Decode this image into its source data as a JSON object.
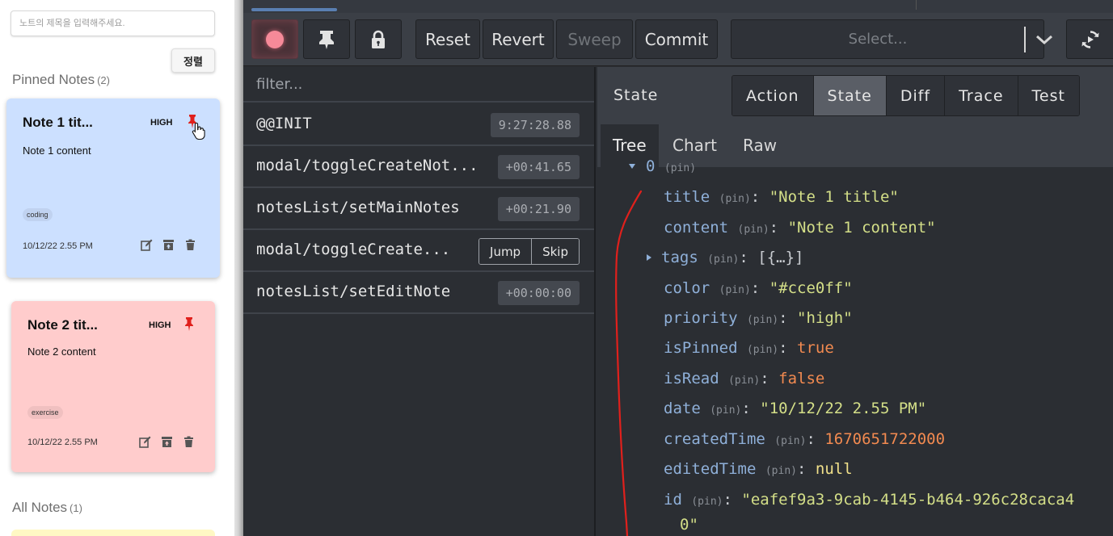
{
  "app": {
    "title_input": {
      "placeholder": "노트의 제목을 입력해주세요.",
      "value": ""
    },
    "sort_label": "정렬",
    "pinned_heading": {
      "label": "Pinned Notes",
      "count": "(2)"
    },
    "all_heading": {
      "label": "All Notes",
      "count": "(1)"
    },
    "notes": [
      {
        "title": "Note 1 tit...",
        "priority": "HIGH",
        "content": "Note 1 content",
        "tag": "coding",
        "date": "10/12/22 2.55 PM",
        "color": "#cce0ff",
        "pinned": true
      },
      {
        "title": "Note 2 tit...",
        "priority": "HIGH",
        "content": "Note 2 content",
        "tag": "exercise",
        "date": "10/12/22 2.55 PM",
        "color": "#ffcccc",
        "pinned": true
      }
    ],
    "icons": {
      "pin": "pin-icon",
      "edit": "edit-icon",
      "archive": "archive-icon",
      "delete": "trash-icon",
      "cursor": "hand-cursor-icon"
    }
  },
  "devtools": {
    "toolbar": {
      "record_icon": "record-icon",
      "pin_icon": "pin-icon",
      "lock_icon": "lock-icon",
      "reset": "Reset",
      "revert": "Revert",
      "sweep": "Sweep",
      "commit": "Commit",
      "select_placeholder": "Select...",
      "sync_icon": "sync-icon"
    },
    "filter_placeholder": "filter...",
    "actions": [
      {
        "name": "@@INIT",
        "time": "9:27:28.88"
      },
      {
        "name": "modal/toggleCreateNot...",
        "time": "+00:41.65"
      },
      {
        "name": "notesList/setMainNotes",
        "time": "+00:21.90"
      },
      {
        "name": "modal/toggleCreate...",
        "jump": "Jump",
        "skip": "Skip"
      },
      {
        "name": "notesList/setEditNote",
        "time": "+00:00:00"
      }
    ],
    "inspector": {
      "title": "State",
      "monitor_tabs": [
        "Action",
        "State",
        "Diff",
        "Trace",
        "Test"
      ],
      "active_monitor_tab": "State",
      "view_tabs": [
        "Tree",
        "Chart",
        "Raw"
      ],
      "active_view_tab": "Tree"
    },
    "state_tree": {
      "root_key": "0",
      "pin_label": "(pin)",
      "fields": [
        {
          "key": "title",
          "value": "\"Note 1 title\"",
          "kind": "string"
        },
        {
          "key": "content",
          "value": "\"Note 1 content\"",
          "kind": "string"
        },
        {
          "key": "tags",
          "value": "[{…}]",
          "kind": "array"
        },
        {
          "key": "color",
          "value": "\"#cce0ff\"",
          "kind": "string"
        },
        {
          "key": "priority",
          "value": "\"high\"",
          "kind": "string"
        },
        {
          "key": "isPinned",
          "value": "true",
          "kind": "boolean"
        },
        {
          "key": "isRead",
          "value": "false",
          "kind": "boolean"
        },
        {
          "key": "date",
          "value": "\"10/12/22 2.55 PM\"",
          "kind": "string"
        },
        {
          "key": "createdTime",
          "value": "1670651722000",
          "kind": "number"
        },
        {
          "key": "editedTime",
          "value": "null",
          "kind": "null"
        },
        {
          "key": "id",
          "value": "\"eafef9a3-9cab-4145-b464-926c28caca4",
          "kind": "string"
        }
      ],
      "id_wrap": "0\""
    }
  },
  "colors": {
    "devtools_bg": "#2b2e33",
    "toolbar_bg": "#3b3f46",
    "string": "#d4df88",
    "number": "#f28a50",
    "key": "#8fb0d9",
    "annotation": "#e0201c"
  }
}
